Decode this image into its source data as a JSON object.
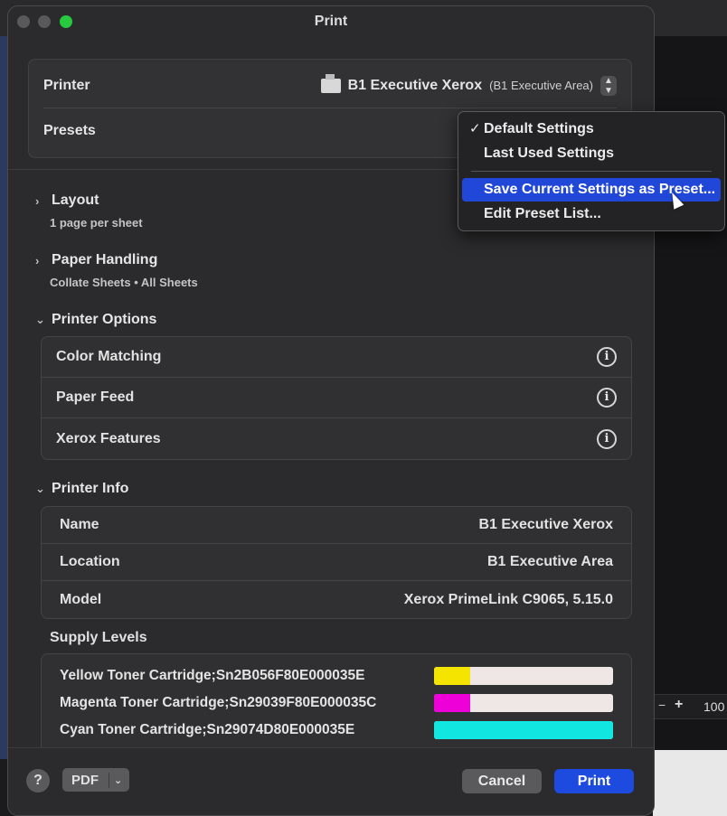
{
  "window": {
    "title": "Print"
  },
  "printer": {
    "label": "Printer",
    "name": "B1 Executive Xerox",
    "location_suffix": "(B1 Executive Area)"
  },
  "presets": {
    "label": "Presets",
    "menu": {
      "default": "Default Settings",
      "last_used": "Last Used Settings",
      "save_current": "Save Current Settings as Preset...",
      "edit_list": "Edit Preset List..."
    },
    "checked": "Default Settings"
  },
  "layout": {
    "title": "Layout",
    "summary": "1 page per sheet"
  },
  "paper_handling": {
    "title": "Paper Handling",
    "summary": "Collate Sheets • All Sheets"
  },
  "printer_options": {
    "title": "Printer Options",
    "items": [
      "Color Matching",
      "Paper Feed",
      "Xerox Features"
    ]
  },
  "printer_info": {
    "title": "Printer Info",
    "rows": [
      {
        "label": "Name",
        "value": "B1 Executive Xerox"
      },
      {
        "label": "Location",
        "value": "B1 Executive Area"
      },
      {
        "label": "Model",
        "value": "Xerox PrimeLink C9065, 5.15.0"
      }
    ]
  },
  "supply_levels": {
    "title": "Supply Levels",
    "items": [
      {
        "label": "Yellow Toner Cartridge;Sn2B056F80E000035E",
        "level": 0.2,
        "color": "#f5e400"
      },
      {
        "label": "Magenta Toner Cartridge;Sn29039F80E000035C",
        "level": 0.2,
        "color": "#ee00d8"
      },
      {
        "label": "Cyan Toner Cartridge;Sn29074D80E000035E",
        "level": 1.0,
        "color": "#12e6e0"
      }
    ]
  },
  "footer": {
    "help": "?",
    "pdf": "PDF",
    "cancel": "Cancel",
    "print": "Print"
  },
  "background": {
    "zoom_minus": "−",
    "zoom_plus": "+",
    "zoom_value": "100"
  },
  "colors": {
    "accent": "#1d4be0",
    "menu_highlight": "#2047d8"
  }
}
